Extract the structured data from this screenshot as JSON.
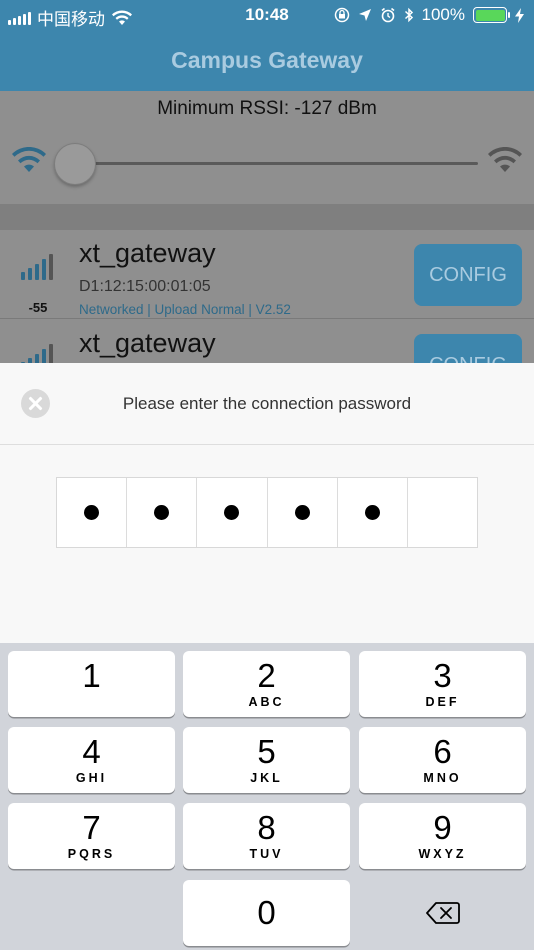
{
  "status_bar": {
    "carrier": "中国移动",
    "time": "10:48",
    "battery": "100%",
    "icons": [
      "signal-icon",
      "wifi-icon",
      "rotation-lock-icon",
      "location-icon",
      "alarm-icon",
      "bluetooth-icon",
      "battery-icon",
      "charging-icon"
    ]
  },
  "navbar": {
    "title": "Campus Gateway"
  },
  "rssi": {
    "label": "Minimum RSSI: -127 dBm"
  },
  "gateways": [
    {
      "name": "xt_gateway",
      "mac": "D1:12:15:00:01:05",
      "status": "Networked  |  Upload Normal  |  V2.52",
      "rssi": "-55",
      "button": "CONFIG"
    },
    {
      "name": "xt_gateway",
      "mac": "",
      "status": "",
      "rssi": "",
      "button": "CONFIG"
    }
  ],
  "dialog": {
    "title": "Please enter the connection password",
    "password_length": 6,
    "filled": 5
  },
  "keypad": {
    "keys": [
      {
        "num": "1",
        "letters": ""
      },
      {
        "num": "2",
        "letters": "ABC"
      },
      {
        "num": "3",
        "letters": "DEF"
      },
      {
        "num": "4",
        "letters": "GHI"
      },
      {
        "num": "5",
        "letters": "JKL"
      },
      {
        "num": "6",
        "letters": "MNO"
      },
      {
        "num": "7",
        "letters": "PQRS"
      },
      {
        "num": "8",
        "letters": "TUV"
      },
      {
        "num": "9",
        "letters": "WXYZ"
      },
      {
        "num": "0",
        "letters": ""
      }
    ]
  },
  "colors": {
    "accent": "#3d86ad",
    "battery": "#59d75a"
  }
}
